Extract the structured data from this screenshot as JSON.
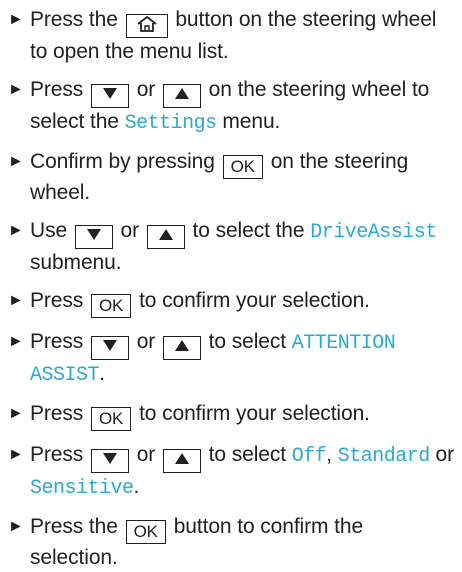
{
  "bullet": "►",
  "keys": {
    "ok": "OK",
    "down": "▼",
    "up": "▲"
  },
  "steps": [
    {
      "a": "Press the",
      "b": "button on the steering wheel to open the menu list."
    },
    {
      "a": "Press",
      "or": "or",
      "b": "on the steering wheel to select the",
      "display": "Settings",
      "c": "menu."
    },
    {
      "a": "Confirm by pressing",
      "b": "on the steering wheel."
    },
    {
      "a": "Use",
      "or": "or",
      "b": "to select the",
      "display": "DriveAssist",
      "c": "submenu."
    },
    {
      "a": "Press",
      "b": "to confirm your selection."
    },
    {
      "a": "Press",
      "or": "or",
      "b": "to select",
      "display": "ATTENTION ASSIST",
      "c": "."
    },
    {
      "a": "Press",
      "b": "to confirm your selection."
    },
    {
      "a": "Press",
      "or": "or",
      "b": "to select",
      "d1": "Off",
      "sep1": ",",
      "d2": "Standard",
      "sep2": "or",
      "d3": "Sensitive",
      "c": "."
    },
    {
      "a": "Press the",
      "b": "button to confirm the selection."
    }
  ]
}
